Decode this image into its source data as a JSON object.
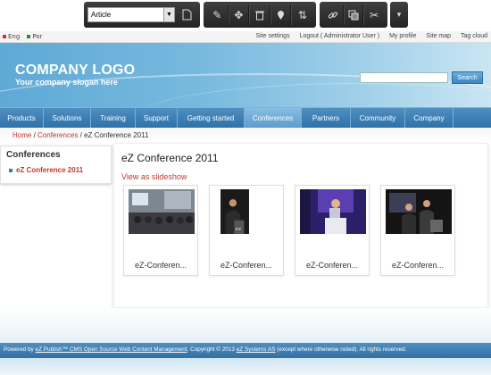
{
  "toolbar": {
    "class_select": "Article",
    "icons": [
      "new-document-icon",
      "edit-icon",
      "move-icon",
      "remove-icon",
      "location-icon",
      "sort-icon",
      "link-icon",
      "copy-icon",
      "settings-icon",
      "minimize-icon"
    ]
  },
  "topnav": {
    "languages": [
      "Eng",
      "Por"
    ],
    "links": [
      "Site settings",
      "Logout ( Administrator User )",
      "My profile",
      "Site map",
      "Tag cloud"
    ]
  },
  "header": {
    "logo": "COMPANY LOGO",
    "slogan": "Your company slogan here",
    "search_button": "Search"
  },
  "mainnav": [
    "Products",
    "Solutions",
    "Training",
    "Support",
    "Getting started",
    "Conferences",
    "Partners",
    "Community",
    "Company"
  ],
  "breadcrumb": {
    "home": "Home",
    "section": "Conferences",
    "current": "eZ Conference 2011"
  },
  "sidebar": {
    "heading": "Conferences",
    "item": "eZ Conference 2011"
  },
  "main": {
    "title": "eZ Conference 2011",
    "slideshow_link": "View as slideshow",
    "thumbs": [
      "eZ-Conferen...",
      "eZ-Conferen...",
      "eZ-Conferen...",
      "eZ-Conferen..."
    ]
  },
  "footer": {
    "text_a": "Powered by ",
    "link_a": "eZ Publish™ CMS Open Source Web Content Management",
    "text_b": ". Copyright © 2013 ",
    "link_b": "eZ Systems AS",
    "text_c": " (except where otherwise noted). All rights reserved."
  },
  "colors": {
    "accent": "#2f72a8",
    "link": "#c0392b"
  }
}
